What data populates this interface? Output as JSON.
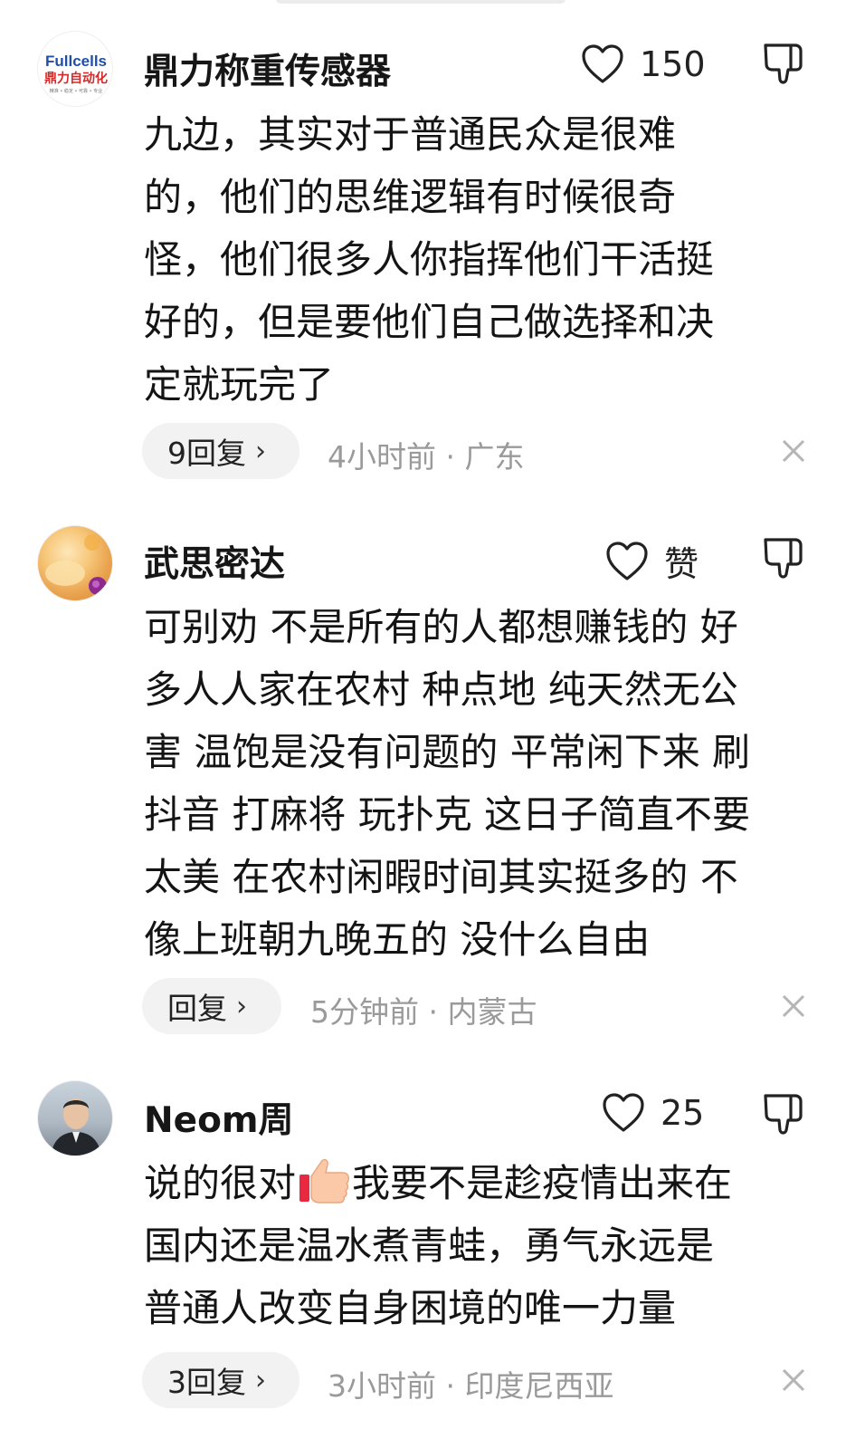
{
  "comments": [
    {
      "username": "鼎力称重传感器",
      "avatar_brand": "Fullcells",
      "avatar_subtitle": "鼎力自动化",
      "avatar_tagline": "精准 • 稳定 • 可靠 • 专业",
      "likes": "150",
      "lines": [
        "九边，其实对于普通民众是很难",
        "的，他们的思维逻辑有时候很奇",
        "怪，他们很多人你指挥他们干活挺",
        "好的，但是要他们自己做选择和决",
        "定就玩完了"
      ],
      "reply_label": "9回复",
      "meta": "4小时前 · 广东"
    },
    {
      "username": "武思密达",
      "likes": "赞",
      "lines": [
        "可别劝 不是所有的人都想赚钱的 好",
        "多人人家在农村 种点地 纯天然无公",
        "害 温饱是没有问题的 平常闲下来 刷",
        "抖音 打麻将 玩扑克 这日子简直不要",
        "太美 在农村闲暇时间其实挺多的 不",
        "像上班朝九晚五的 没什么自由"
      ],
      "reply_label": "回复",
      "meta": "5分钟前 · 内蒙古"
    },
    {
      "username": "Neom周",
      "likes": "25",
      "lines": [
        "说的很对",
        "我要不是趁疫情出来在",
        "国内还是温水煮青蛙，勇气永远是",
        "普通人改变自身困境的唯一力量"
      ],
      "reply_label": "3回复",
      "meta": "3小时前 · 印度尼西亚"
    }
  ],
  "icons": {
    "like": "heart-outline-icon",
    "dislike": "thumbs-down-outline-icon",
    "close": "close-icon",
    "chevron": "›",
    "emoji": "thumbs-up-emoji"
  },
  "colors": {
    "text": "#141414",
    "meta": "#9a9a9a",
    "pill": "#f2f2f2",
    "brand_blue": "#1f4fa8",
    "brand_red": "#d42a2a"
  }
}
